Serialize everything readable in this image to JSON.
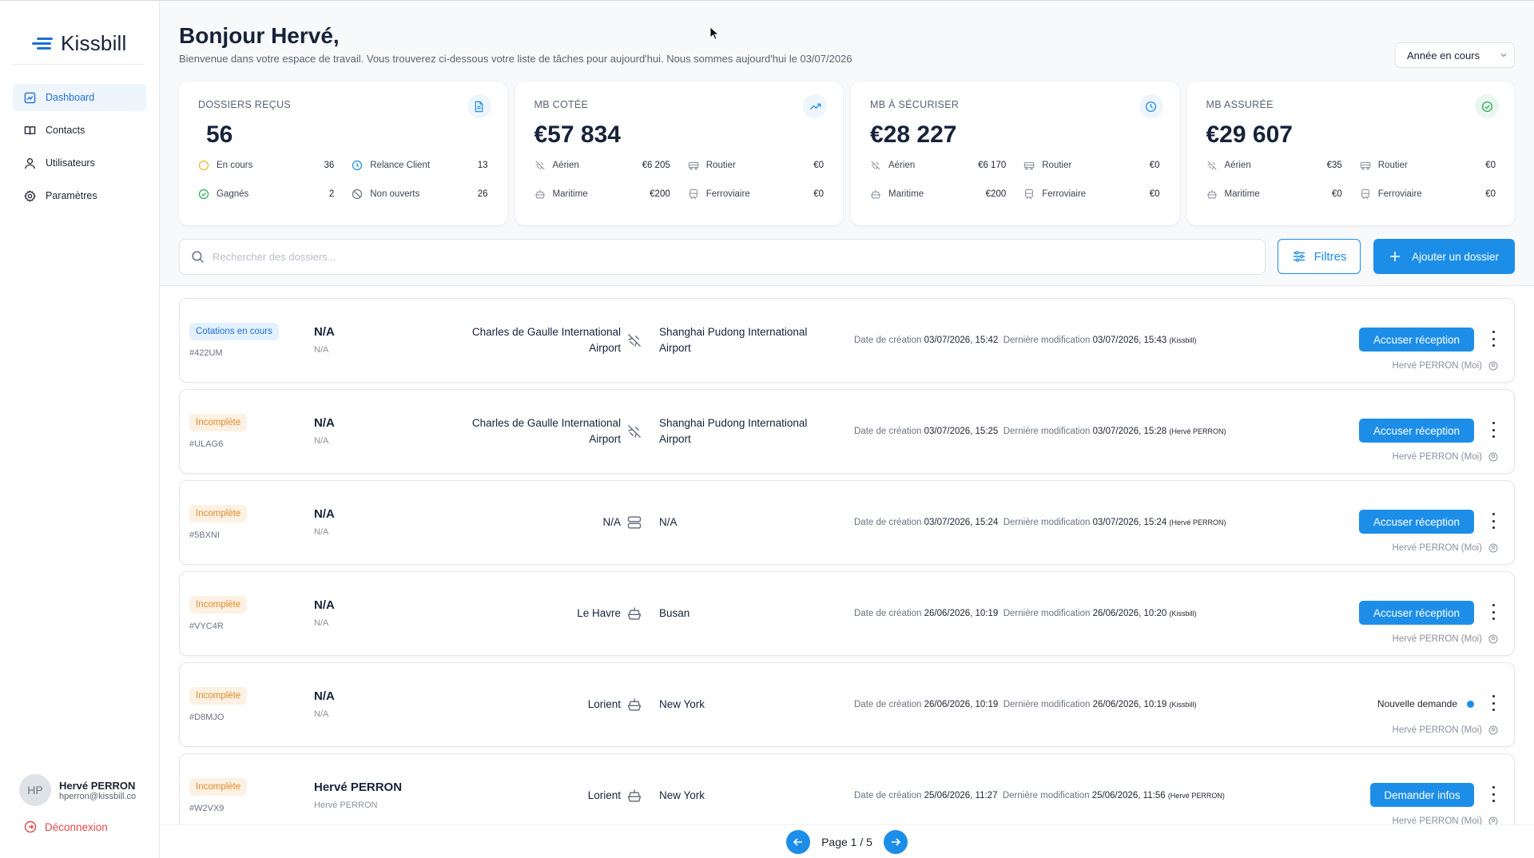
{
  "app": {
    "logo_text": "Kissbill"
  },
  "sidebar": {
    "items": [
      {
        "label": "Dashboard",
        "icon": "dashboard-icon"
      },
      {
        "label": "Contacts",
        "icon": "book-icon"
      },
      {
        "label": "Utilisateurs",
        "icon": "user-icon"
      },
      {
        "label": "Paramètres",
        "icon": "gear-icon"
      }
    ],
    "user": {
      "initials": "HP",
      "name": "Hervé PERRON",
      "email": "hperron@kissbill.co"
    },
    "logout": "Déconnexion"
  },
  "header": {
    "title": "Bonjour Hervé,",
    "subtitle": "Bienvenue dans votre espace de travail. Vous trouverez ci-dessous votre liste de tâches pour aujourd'hui. Nous sommes aujourd'hui le 03/07/2026",
    "period_select": "Année en cours"
  },
  "cards": {
    "received": {
      "title": "DOSSIERS REÇUS",
      "value": "56",
      "stats": [
        {
          "label": "En cours",
          "value": "36"
        },
        {
          "label": "Relance Client",
          "value": "13"
        },
        {
          "label": "Gagnés",
          "value": "2"
        },
        {
          "label": "Non ouverts",
          "value": "26"
        }
      ]
    },
    "quoted": {
      "title": "MB COTÉE",
      "value": "€57 834",
      "stats": [
        {
          "label": "Aérien",
          "value": "€6 205"
        },
        {
          "label": "Routier",
          "value": "€0"
        },
        {
          "label": "Maritime",
          "value": "€200"
        },
        {
          "label": "Ferroviaire",
          "value": "€0"
        }
      ]
    },
    "to_secure": {
      "title": "MB À SÉCURISER",
      "value": "€28 227",
      "stats": [
        {
          "label": "Aérien",
          "value": "€6 170"
        },
        {
          "label": "Routier",
          "value": "€0"
        },
        {
          "label": "Maritime",
          "value": "€200"
        },
        {
          "label": "Ferroviaire",
          "value": "€0"
        }
      ]
    },
    "secured": {
      "title": "MB ASSURÉE",
      "value": "€29 607",
      "stats": [
        {
          "label": "Aérien",
          "value": "€35"
        },
        {
          "label": "Routier",
          "value": "€0"
        },
        {
          "label": "Maritime",
          "value": "€0"
        },
        {
          "label": "Ferroviaire",
          "value": "€0"
        }
      ]
    }
  },
  "toolbar": {
    "search_placeholder": "Rechercher des dossiers...",
    "filter_label": "Filtres",
    "add_label": "Ajouter un dossier"
  },
  "labels": {
    "created": "Date de création",
    "modified": "Dernière modification"
  },
  "rows": [
    {
      "status": "Cotations en cours",
      "ref": "#422UM",
      "client": "N/A",
      "client_sub": "N/A",
      "origin_l1": "Charles de Gaulle International",
      "origin_l2": "Airport",
      "dest_l1": "Shanghai Pudong International",
      "dest_l2": "Airport",
      "created": "03/07/2026, 15:42",
      "modified": "03/07/2026, 15:43",
      "modified_by": "(Kissbill)",
      "action": "Accuser réception",
      "owner": "Hervé PERRON (Moi)"
    },
    {
      "status": "Incomplète",
      "ref": "#ULAG6",
      "client": "N/A",
      "client_sub": "N/A",
      "origin_l1": "Charles de Gaulle International",
      "origin_l2": "Airport",
      "dest_l1": "Shanghai Pudong International",
      "dest_l2": "Airport",
      "created": "03/07/2026, 15:25",
      "modified": "03/07/2026, 15:28",
      "modified_by": "(Hervé PERRON)",
      "action": "Accuser réception",
      "owner": "Hervé PERRON (Moi)"
    },
    {
      "status": "Incomplète",
      "ref": "#5BXNI",
      "client": "N/A",
      "client_sub": "N/A",
      "origin_l1": "N/A",
      "origin_l2": "",
      "dest_l1": "N/A",
      "dest_l2": "",
      "created": "03/07/2026, 15:24",
      "modified": "03/07/2026, 15:24",
      "modified_by": "(Hervé PERRON)",
      "action": "Accuser réception",
      "owner": "Hervé PERRON (Moi)"
    },
    {
      "status": "Incomplète",
      "ref": "#VYC4R",
      "client": "N/A",
      "client_sub": "N/A",
      "origin_l1": "Le Havre",
      "origin_l2": "",
      "dest_l1": "Busan",
      "dest_l2": "",
      "created": "26/06/2026, 10:19",
      "modified": "26/06/2026, 10:20",
      "modified_by": "(Kissbill)",
      "action": "Accuser réception",
      "owner": "Hervé PERRON (Moi)"
    },
    {
      "status": "Incomplète",
      "ref": "#D8MJO",
      "client": "N/A",
      "client_sub": "N/A",
      "origin_l1": "Lorient",
      "origin_l2": "",
      "dest_l1": "New York",
      "dest_l2": "",
      "created": "26/06/2026, 10:19",
      "modified": "26/06/2026, 10:19",
      "modified_by": "(Kissbill)",
      "action": "Nouvelle demande",
      "owner": "Hervé PERRON (Moi)"
    },
    {
      "status": "Incomplète",
      "ref": "#W2VX9",
      "client": "Hervé PERRON",
      "client_sub": "Hervé PERRON",
      "origin_l1": "Lorient",
      "origin_l2": "",
      "dest_l1": "New York",
      "dest_l2": "",
      "created": "25/06/2026, 11:27",
      "modified": "25/06/2026, 11:56",
      "modified_by": "(Hervé PERRON)",
      "action": "Demander infos",
      "owner": "Hervé PERRON (Moi)"
    }
  ],
  "pager": {
    "label": "Page 1 / 5"
  },
  "colors": {
    "primary": "#1d8ee8",
    "brand": "#1d6fd8",
    "danger": "#e04a4a",
    "orange": "#e08a2b"
  }
}
